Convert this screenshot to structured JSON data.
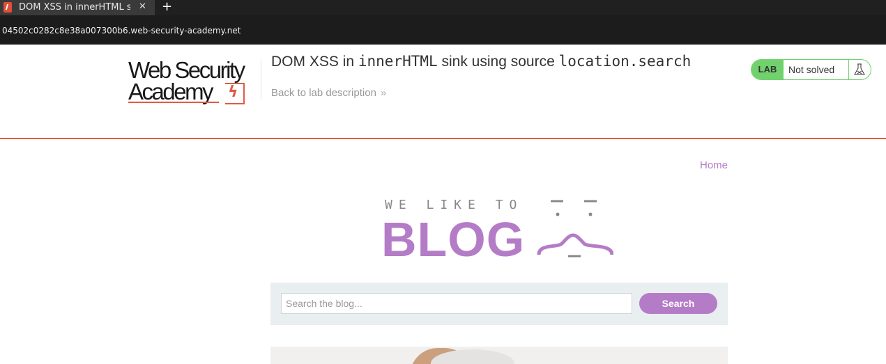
{
  "browser": {
    "tab_title": "DOM XSS in innerHTML s",
    "close_glyph": "✕",
    "new_tab_glyph": "+",
    "url": "04502c0282c8e38a007300b6.web-security-academy.net"
  },
  "header": {
    "logo_line1": "Web Security",
    "logo_line2": "Academy",
    "logo_bolt": "ϟ",
    "title_pre": "DOM XSS in ",
    "title_code1": "innerHTML",
    "title_mid": " sink using source ",
    "title_code2": "location.search",
    "back_link": "Back to lab description",
    "back_chevron": "»",
    "status_label": "LAB",
    "status_text": "Not solved",
    "accent_color": "#e05a45",
    "status_color": "#70d16d"
  },
  "nav": {
    "home": "Home"
  },
  "blog": {
    "tagline": "WE LIKE TO",
    "name": "BLOG",
    "brand_color": "#b47cc7"
  },
  "search": {
    "placeholder": "Search the blog...",
    "value": "",
    "button": "Search"
  }
}
